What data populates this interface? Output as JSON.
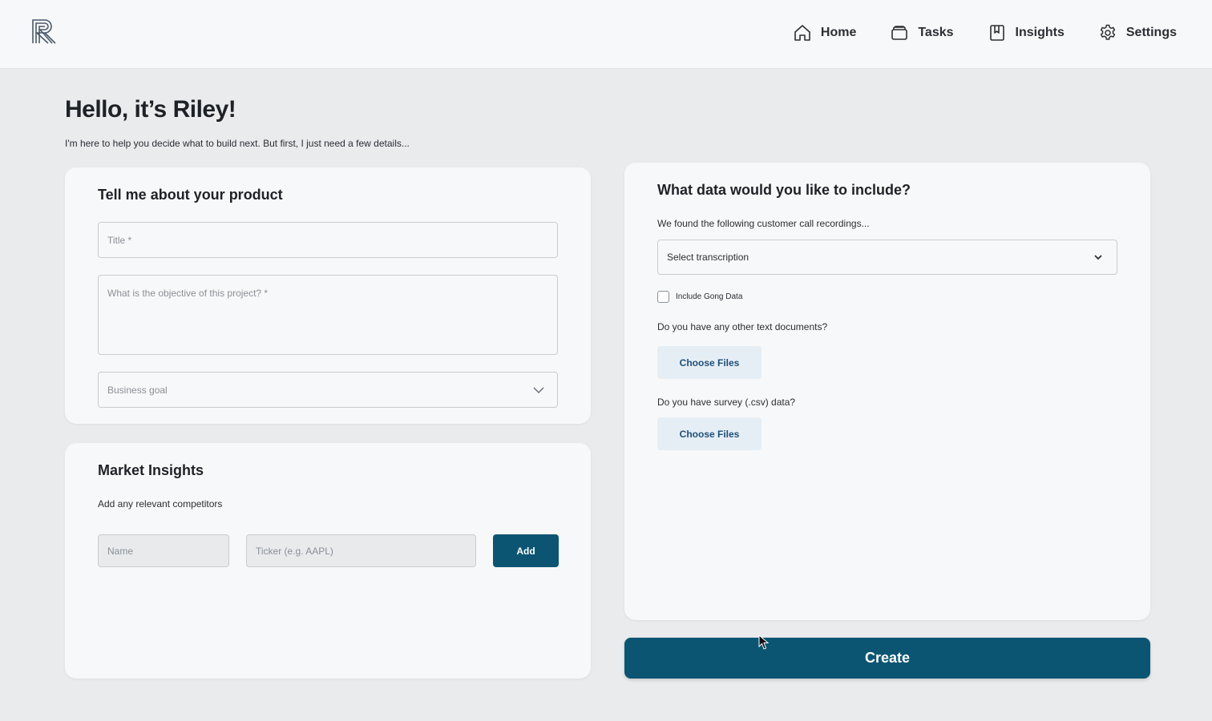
{
  "header": {
    "logo_icon": "r-logo-icon",
    "nav": [
      {
        "label": "Home",
        "icon": "home-icon"
      },
      {
        "label": "Tasks",
        "icon": "tasks-icon"
      },
      {
        "label": "Insights",
        "icon": "book-icon"
      },
      {
        "label": "Settings",
        "icon": "gear-icon"
      }
    ]
  },
  "intro": {
    "greeting": "Hello, it’s Riley!",
    "subtitle": "I'm here to help you decide what to build next. But first, I just need a few details..."
  },
  "product": {
    "title": "Tell me about your product",
    "title_placeholder": "Title *",
    "objective_placeholder": "What is the objective of this project? *",
    "business_goal_placeholder": "Business goal"
  },
  "market": {
    "title": "Market Insights",
    "subtitle": "Add any relevant competitors",
    "name_placeholder": "Name",
    "ticker_placeholder": "Ticker (e.g. AAPL)",
    "add_label": "Add"
  },
  "data": {
    "title": "What data would you like to include?",
    "recordings_label": "We found the following customer call recordings...",
    "transcription_placeholder": "Select transcription",
    "gong_label": "Include Gong Data",
    "gong_checked": false,
    "text_docs_label": "Do you have any other text documents?",
    "choose_files_1": "Choose Files",
    "survey_label": "Do you have survey (.csv) data?",
    "choose_files_2": "Choose Files"
  },
  "actions": {
    "create_label": "Create"
  },
  "colors": {
    "primary": "#0b5573",
    "background": "#e9ebed",
    "card": "#f7f8f9",
    "choose_files_bg": "#e6eef5"
  }
}
